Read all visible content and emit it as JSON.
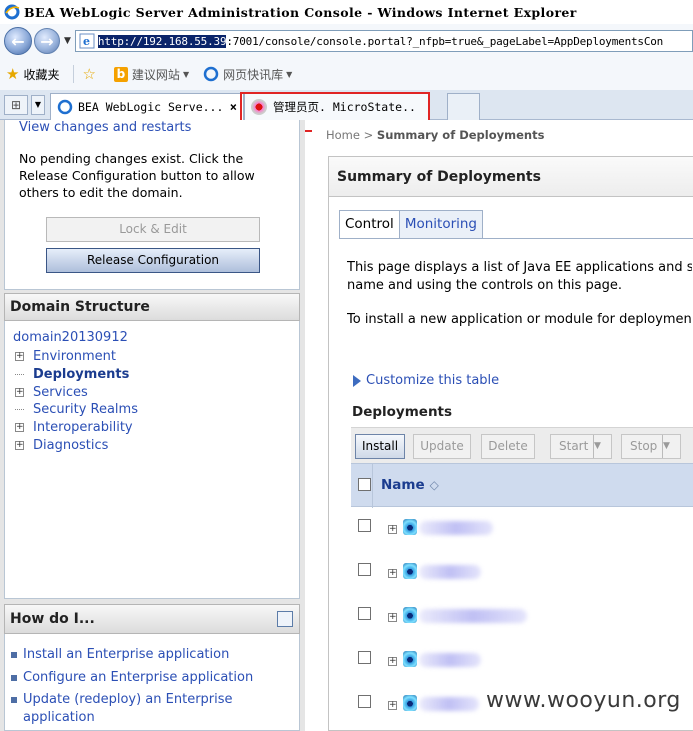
{
  "window": {
    "title": "BEA WebLogic Server Administration Console - Windows Internet Explorer"
  },
  "address_bar": {
    "url_selected": "http://192.168.55.39",
    "url_rest": ":7001/console/console.portal?_nfpb=true&_pageLabel=AppDeploymentsCon"
  },
  "favorites_bar": {
    "favorites_label": "收藏夹",
    "suggested_sites": "建议网站",
    "web_slice": "网页快讯库"
  },
  "browser_tabs": [
    {
      "label": "BEA WebLogic Serve...",
      "close": "×"
    },
    {
      "label": "管理员页. MicroState.."
    }
  ],
  "left_panel": {
    "changes": {
      "link": "View changes and restarts",
      "message": "No pending changes exist. Click the Release Configuration button to allow others to edit the domain.",
      "lock_button": "Lock & Edit",
      "release_button": "Release Configuration"
    },
    "domain_structure": {
      "title": "Domain Structure",
      "root": "domain20130912",
      "items": [
        {
          "label": "Environment",
          "expandable": true
        },
        {
          "label": "Deployments",
          "expandable": false,
          "selected": true
        },
        {
          "label": "Services",
          "expandable": true
        },
        {
          "label": "Security Realms",
          "expandable": false
        },
        {
          "label": "Interoperability",
          "expandable": true
        },
        {
          "label": "Diagnostics",
          "expandable": true
        }
      ]
    },
    "how_do_i": {
      "title": "How do I...",
      "items": [
        "Install an Enterprise application",
        "Configure an Enterprise application",
        "Update (redeploy) an Enterprise application"
      ]
    }
  },
  "content": {
    "breadcrumb_home": "Home",
    "breadcrumb_sep": ">",
    "breadcrumb_current": "Summary of Deployments",
    "panel_title": "Summary of Deployments",
    "tabs": [
      "Control",
      "Monitoring"
    ],
    "description_1": "This page displays a list of Java EE applications and sta",
    "description_1b": "name and using the controls on this page.",
    "description_2": "To install a new application or module for deployment t",
    "customize_link": "Customize this table",
    "table_title": "Deployments",
    "toolbar": {
      "install": "Install",
      "update": "Update",
      "delete": "Delete",
      "start": "Start",
      "stop": "Stop"
    },
    "columns": {
      "name": "Name"
    },
    "rows": 5
  },
  "watermark": "www.wooyun.org",
  "colors": {
    "link": "#2b4fb5",
    "header_bg": "#cfdbee",
    "highlight_box": "#e02424"
  }
}
